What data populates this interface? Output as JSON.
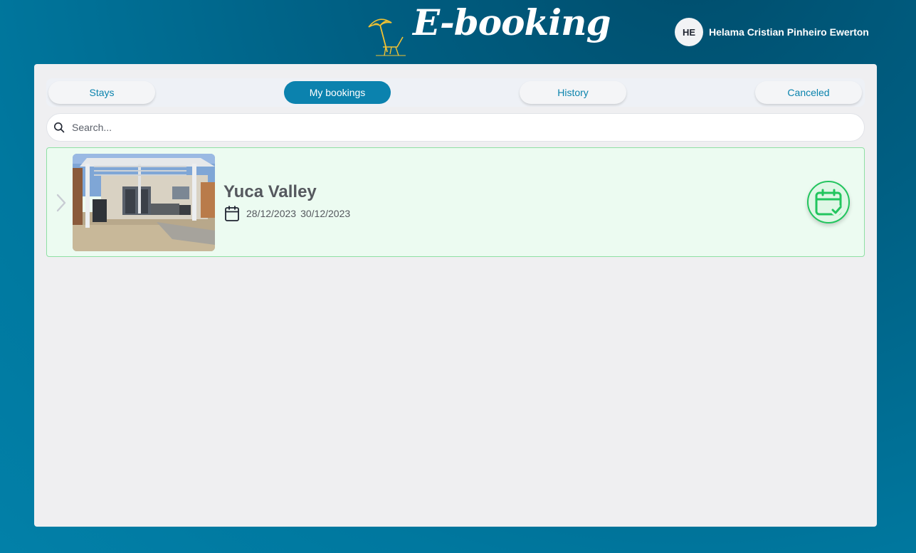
{
  "app": {
    "logo_text": "E-booking",
    "logo_icon": "beach-umbrella-chair-icon"
  },
  "user": {
    "initials": "HE",
    "name": "Helama Cristian Pinheiro Ewerton"
  },
  "tabs": [
    {
      "label": "Stays",
      "active": false
    },
    {
      "label": "My bookings",
      "active": true
    },
    {
      "label": "History",
      "active": false
    },
    {
      "label": "Canceled",
      "active": false
    }
  ],
  "search": {
    "placeholder": "Search...",
    "value": "",
    "icon": "search-icon"
  },
  "bookings": [
    {
      "title": "Yuca Valley",
      "check_in": "28/12/2023",
      "check_out": "30/12/2023",
      "status_icon": "calendar-check-icon",
      "status_color": "#22c55e"
    }
  ],
  "colors": {
    "accent": "#0b82ae",
    "success": "#22c55e",
    "card_background": "#ecfbf1"
  }
}
